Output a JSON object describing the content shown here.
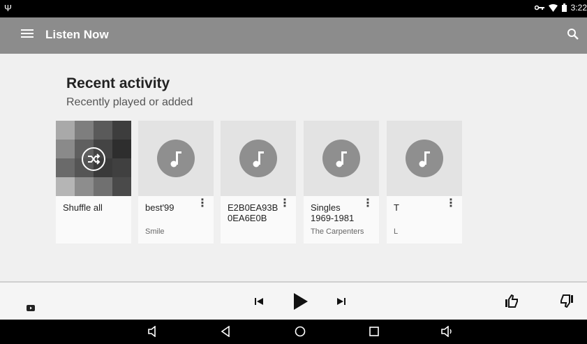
{
  "status_bar": {
    "time": "3:22"
  },
  "app_bar": {
    "title": "Listen Now"
  },
  "section": {
    "title": "Recent activity",
    "subtitle": "Recently played or added"
  },
  "cards": [
    {
      "title": "Shuffle all",
      "subtitle": ""
    },
    {
      "title": "best'99",
      "subtitle": "Smile"
    },
    {
      "title": "E2B0EA93B\n0EA6E0B",
      "subtitle": ""
    },
    {
      "title": "Singles\n1969-1981",
      "subtitle": "The Carpenters"
    },
    {
      "title": "T",
      "subtitle": "L"
    }
  ],
  "mosaic_colors": [
    "#a9a9a9",
    "#7e7e7e",
    "#5a5a5a",
    "#3d3d3d",
    "#8a8a8a",
    "#5f5f5f",
    "#444444",
    "#2e2e2e",
    "#6a6a6a",
    "#555555",
    "#3a3a3a",
    "#404040",
    "#b5b5b5",
    "#8d8d8d",
    "#707070",
    "#4a4a4a"
  ],
  "icons": {
    "status": [
      "usb-icon",
      "vpn-key-icon",
      "wifi-icon",
      "battery-icon"
    ],
    "app_bar": [
      "menu-icon",
      "search-icon"
    ],
    "player": [
      "cast-icon",
      "skip-previous-icon",
      "play-icon",
      "skip-next-icon",
      "thumbs-up-icon",
      "thumbs-down-icon"
    ],
    "nav": [
      "volume-down-icon",
      "back-icon",
      "home-icon",
      "recents-icon",
      "volume-up-icon"
    ]
  }
}
